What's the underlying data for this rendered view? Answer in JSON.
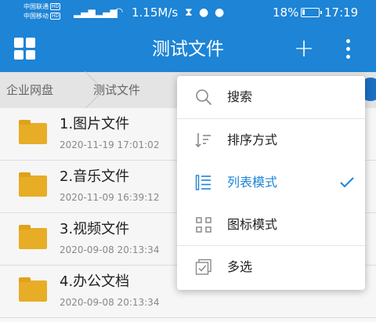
{
  "status_bar": {
    "carrier_1": "中国联通",
    "carrier_2": "中国移动",
    "hd_badge": "HD",
    "signal_1": "⁴ᴳ",
    "signal_2": "⁴ᴳ",
    "network_speed": "1.15M/s",
    "battery_percent": "18%",
    "battery_level": 0.18,
    "time": "17:19"
  },
  "app_bar": {
    "title": "测试文件",
    "add_glyph": "+"
  },
  "breadcrumb": {
    "items": [
      "企业网盘",
      "测试文件"
    ]
  },
  "files": [
    {
      "name": "1.图片文件",
      "date": "2020-11-19 17:01:02"
    },
    {
      "name": "2.音乐文件",
      "date": "2020-11-09 16:39:12"
    },
    {
      "name": "3.视频文件",
      "date": "2020-09-08 20:13:34"
    },
    {
      "name": "4.办公文档",
      "date": "2020-09-08 20:13:34"
    }
  ],
  "menu": {
    "items": [
      {
        "label": "搜索",
        "icon": "search-icon"
      },
      {
        "label": "排序方式",
        "icon": "sort-icon"
      },
      {
        "label": "列表模式",
        "icon": "list-icon",
        "selected": true
      },
      {
        "label": "图标模式",
        "icon": "grid-icon"
      },
      {
        "label": "多选",
        "icon": "multi-select-icon"
      }
    ]
  },
  "colors": {
    "primary": "#1d84d6",
    "folder": "#f0b428",
    "breadcrumb_bg": "#e4e4e4"
  }
}
